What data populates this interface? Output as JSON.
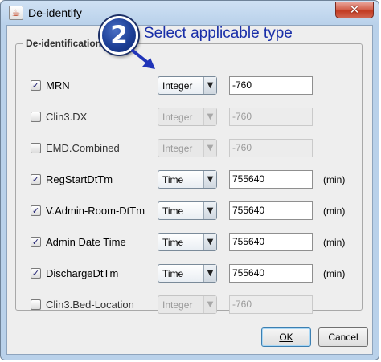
{
  "window": {
    "title": "De-identify",
    "app_icon": "java-cup-icon",
    "close_glyph": "✕"
  },
  "group": {
    "legend": "De-identification"
  },
  "rows": [
    {
      "checked": true,
      "check_glyph": "✓",
      "label": "MRN",
      "type": "Integer",
      "value": "-760",
      "unit": "",
      "enabled": true
    },
    {
      "checked": false,
      "check_glyph": "",
      "label": "Clin3.DX",
      "type": "Integer",
      "value": "-760",
      "unit": "",
      "enabled": false
    },
    {
      "checked": false,
      "check_glyph": "",
      "label": "EMD.Combined",
      "type": "Integer",
      "value": "-760",
      "unit": "",
      "enabled": false
    },
    {
      "checked": true,
      "check_glyph": "✓",
      "label": "RegStartDtTm",
      "type": "Time",
      "value": "755640",
      "unit": "(min)",
      "enabled": true
    },
    {
      "checked": true,
      "check_glyph": "✓",
      "label": "V.Admin-Room-DtTm",
      "type": "Time",
      "value": "755640",
      "unit": "(min)",
      "enabled": true
    },
    {
      "checked": true,
      "check_glyph": "✓",
      "label": "Admin Date Time",
      "type": "Time",
      "value": "755640",
      "unit": "(min)",
      "enabled": true
    },
    {
      "checked": true,
      "check_glyph": "✓",
      "label": "DischargeDtTm",
      "type": "Time",
      "value": "755640",
      "unit": "(min)",
      "enabled": true
    },
    {
      "checked": false,
      "check_glyph": "",
      "label": "Clin3.Bed-Location",
      "type": "Integer",
      "value": "-760",
      "unit": "",
      "enabled": false
    }
  ],
  "combo_arrow_glyph": "▼",
  "buttons": {
    "ok": "OK",
    "cancel": "Cancel"
  },
  "callout": {
    "number": "2",
    "text": "Select applicable type",
    "color": "#1a2fa8"
  }
}
